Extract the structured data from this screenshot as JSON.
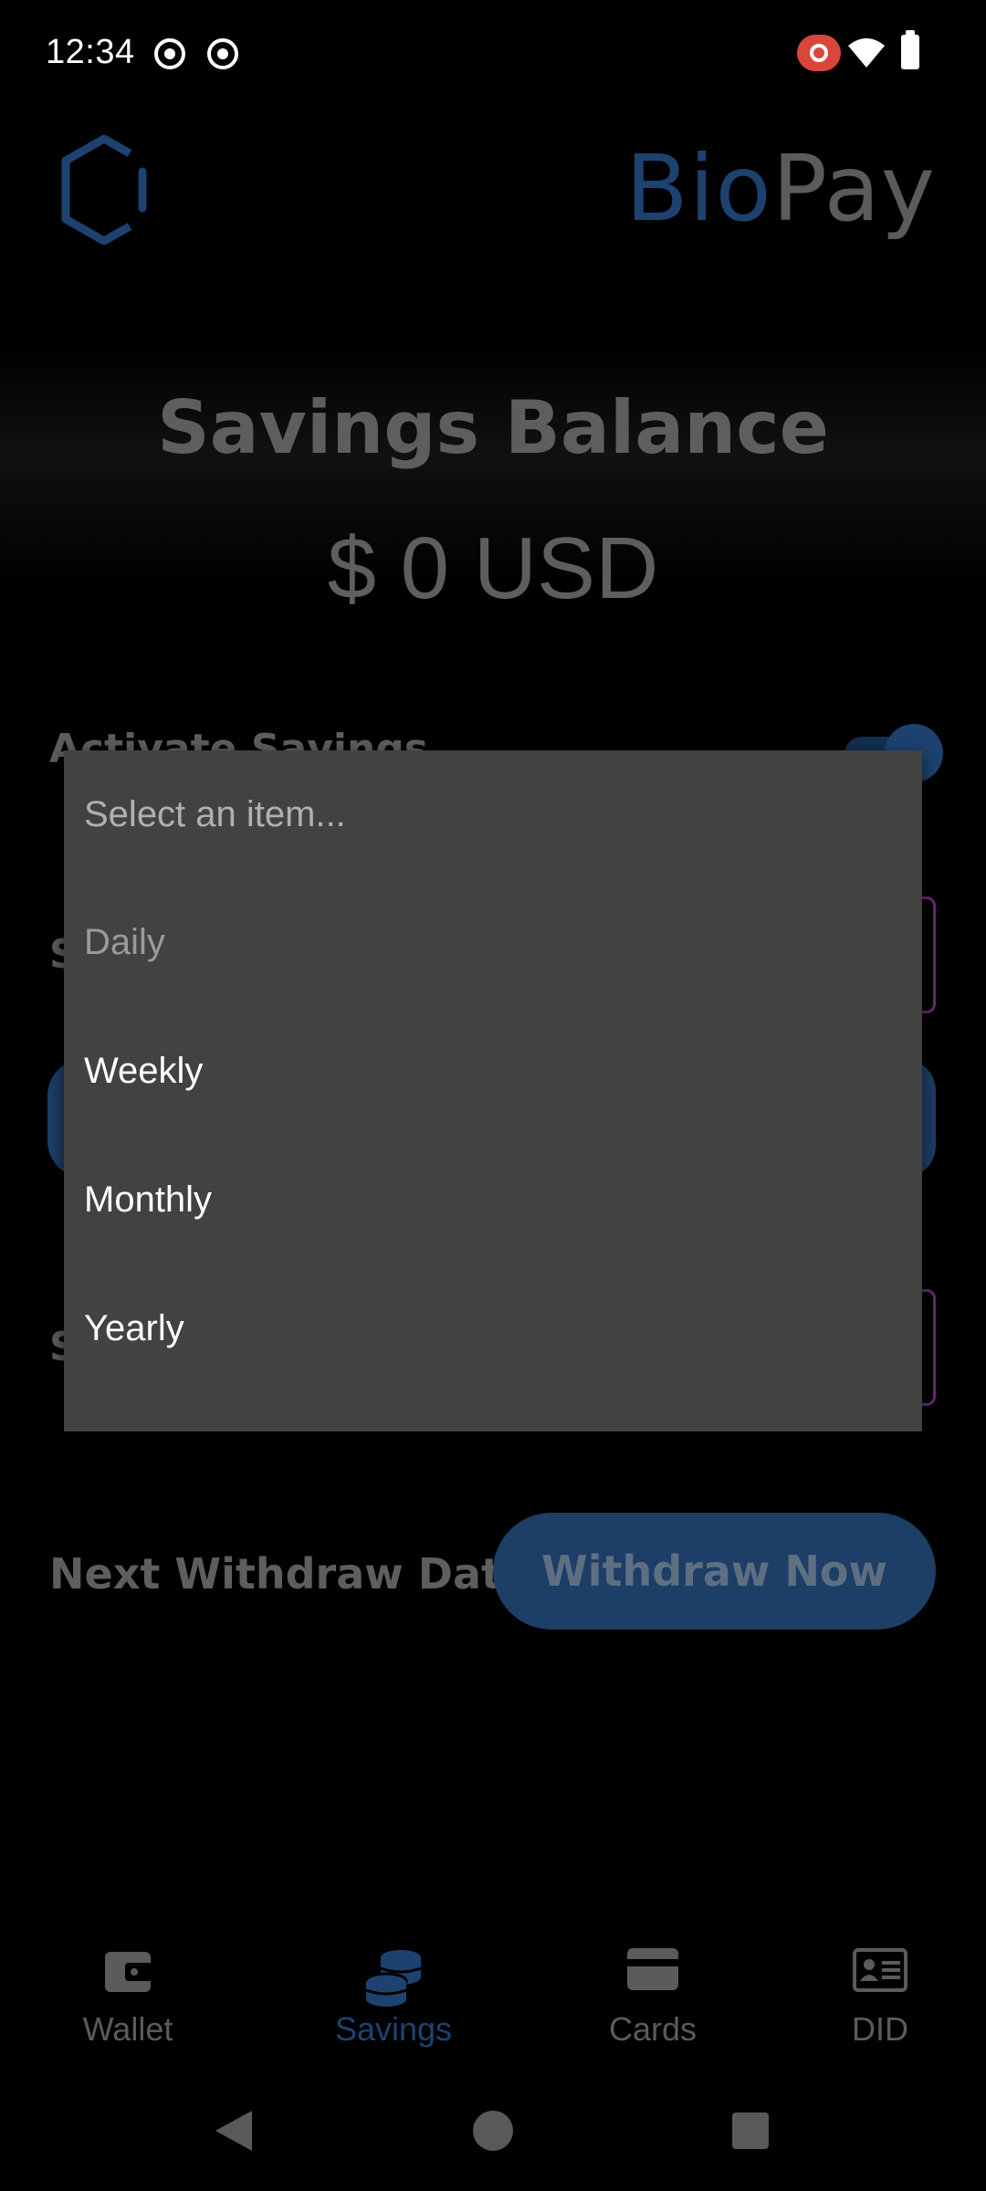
{
  "status_bar": {
    "time": "12:34",
    "icons": [
      "screen-cast-icon",
      "screen-cast-icon",
      "screen-record-icon",
      "wifi-icon",
      "battery-icon"
    ]
  },
  "header": {
    "brand_part1": "Bio",
    "brand_part2": "Pay",
    "logo_icon": "hexagon-logo-icon"
  },
  "balance": {
    "title": "Savings Balance",
    "value": "$ 0 USD"
  },
  "form": {
    "activate_savings_label": "Activate Savings",
    "row2_label_fragment": "S",
    "row4_label_fragment": "S",
    "next_withdraw_label": "Next Withdraw Date",
    "withdraw_button": "Withdraw Now"
  },
  "dropdown": {
    "placeholder": "Select an item...",
    "options": [
      {
        "label": "Daily",
        "enabled": false
      },
      {
        "label": "Weekly",
        "enabled": true
      },
      {
        "label": "Monthly",
        "enabled": true
      },
      {
        "label": "Yearly",
        "enabled": true
      }
    ]
  },
  "bottom_nav": {
    "items": [
      {
        "label": "Wallet",
        "icon": "wallet-icon",
        "active": false
      },
      {
        "label": "Savings",
        "icon": "coins-stack-icon",
        "active": true
      },
      {
        "label": "Cards",
        "icon": "credit-card-icon",
        "active": false
      },
      {
        "label": "DID",
        "icon": "id-card-icon",
        "active": false
      }
    ]
  },
  "colors": {
    "accent_blue": "#1d4270",
    "dim_gray": "#5e5e5e",
    "dropdown_bg": "#424242",
    "field_border": "#6a2a72",
    "recording_red": "#d8463c"
  }
}
